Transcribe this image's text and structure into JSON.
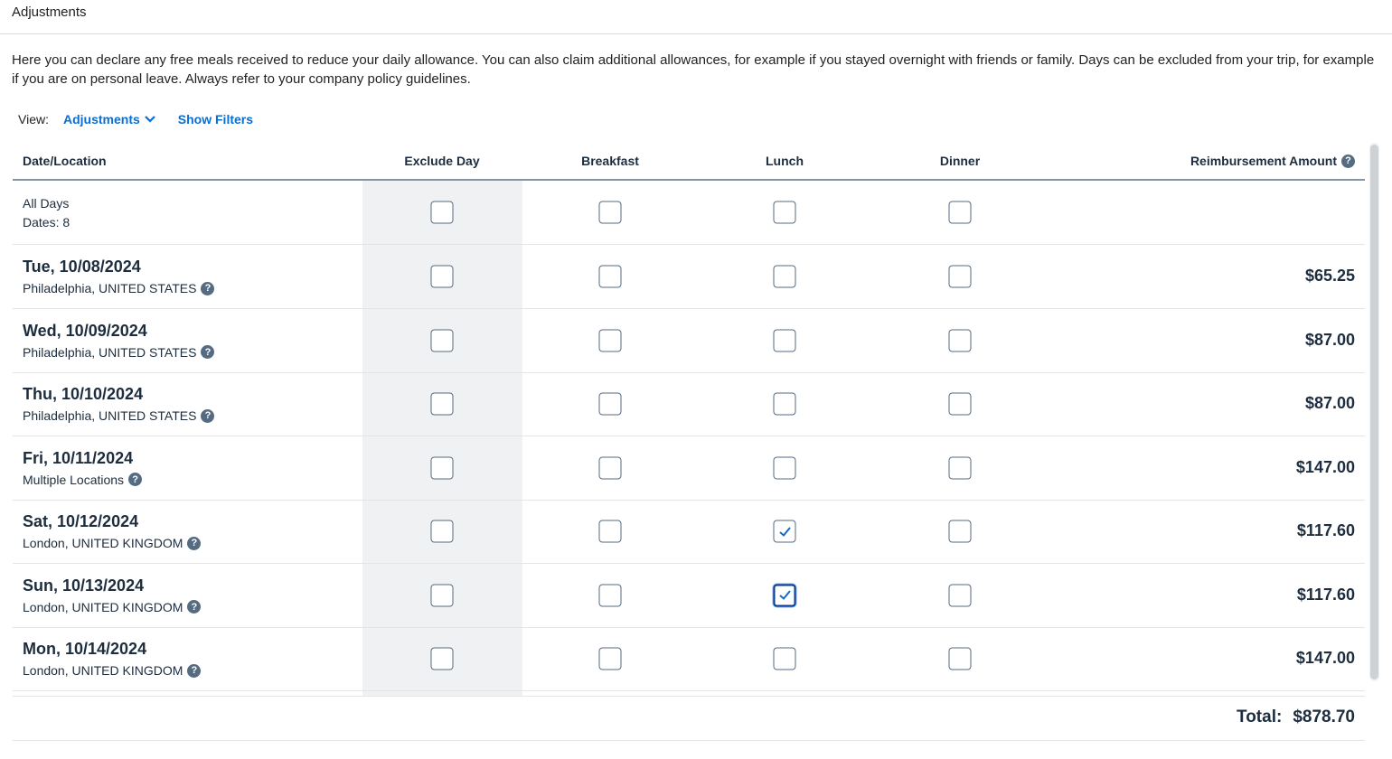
{
  "header": {
    "title": "Adjustments"
  },
  "intro": "Here you can declare any free meals received to reduce your daily allowance. You can also claim additional allowances, for example if you stayed overnight with friends or family. Days can be excluded from your trip, for example if you are on personal leave. Always refer to your company policy guidelines.",
  "viewbar": {
    "label": "View:",
    "selected_view": "Adjustments",
    "filters_label": "Show Filters"
  },
  "table": {
    "columns": {
      "date_location": "Date/Location",
      "exclude_day": "Exclude Day",
      "breakfast": "Breakfast",
      "lunch": "Lunch",
      "dinner": "Dinner",
      "reimbursement": "Reimbursement Amount"
    },
    "all_days": {
      "label": "All Days",
      "dates": "Dates: 8"
    },
    "rows": [
      {
        "date": "Tue, 10/08/2024",
        "location": "Philadelphia, UNITED STATES",
        "amount": "$65.25",
        "exclude": false,
        "breakfast": false,
        "lunch": false,
        "dinner": false
      },
      {
        "date": "Wed, 10/09/2024",
        "location": "Philadelphia, UNITED STATES",
        "amount": "$87.00",
        "exclude": false,
        "breakfast": false,
        "lunch": false,
        "dinner": false
      },
      {
        "date": "Thu, 10/10/2024",
        "location": "Philadelphia, UNITED STATES",
        "amount": "$87.00",
        "exclude": false,
        "breakfast": false,
        "lunch": false,
        "dinner": false
      },
      {
        "date": "Fri, 10/11/2024",
        "location": "Multiple Locations",
        "amount": "$147.00",
        "exclude": false,
        "breakfast": false,
        "lunch": false,
        "dinner": false
      },
      {
        "date": "Sat, 10/12/2024",
        "location": "London, UNITED KINGDOM",
        "amount": "$117.60",
        "exclude": false,
        "breakfast": false,
        "lunch": true,
        "dinner": false
      },
      {
        "date": "Sun, 10/13/2024",
        "location": "London, UNITED KINGDOM",
        "amount": "$117.60",
        "exclude": false,
        "breakfast": false,
        "lunch": true,
        "dinner": false,
        "lunch_focused": true
      },
      {
        "date": "Mon, 10/14/2024",
        "location": "London, UNITED KINGDOM",
        "amount": "$147.00",
        "exclude": false,
        "breakfast": false,
        "lunch": false,
        "dinner": false
      }
    ]
  },
  "footer": {
    "total_label": "Total:",
    "total_value": "$878.70"
  },
  "icons": {
    "help": "question-circle-icon",
    "dropdown": "chevron-down-icon",
    "check": "checkmark-icon"
  },
  "colors": {
    "link": "#0a6ed1",
    "text": "#1d2d3e",
    "help_icon": "#556b82",
    "shade": "#eff1f2"
  }
}
